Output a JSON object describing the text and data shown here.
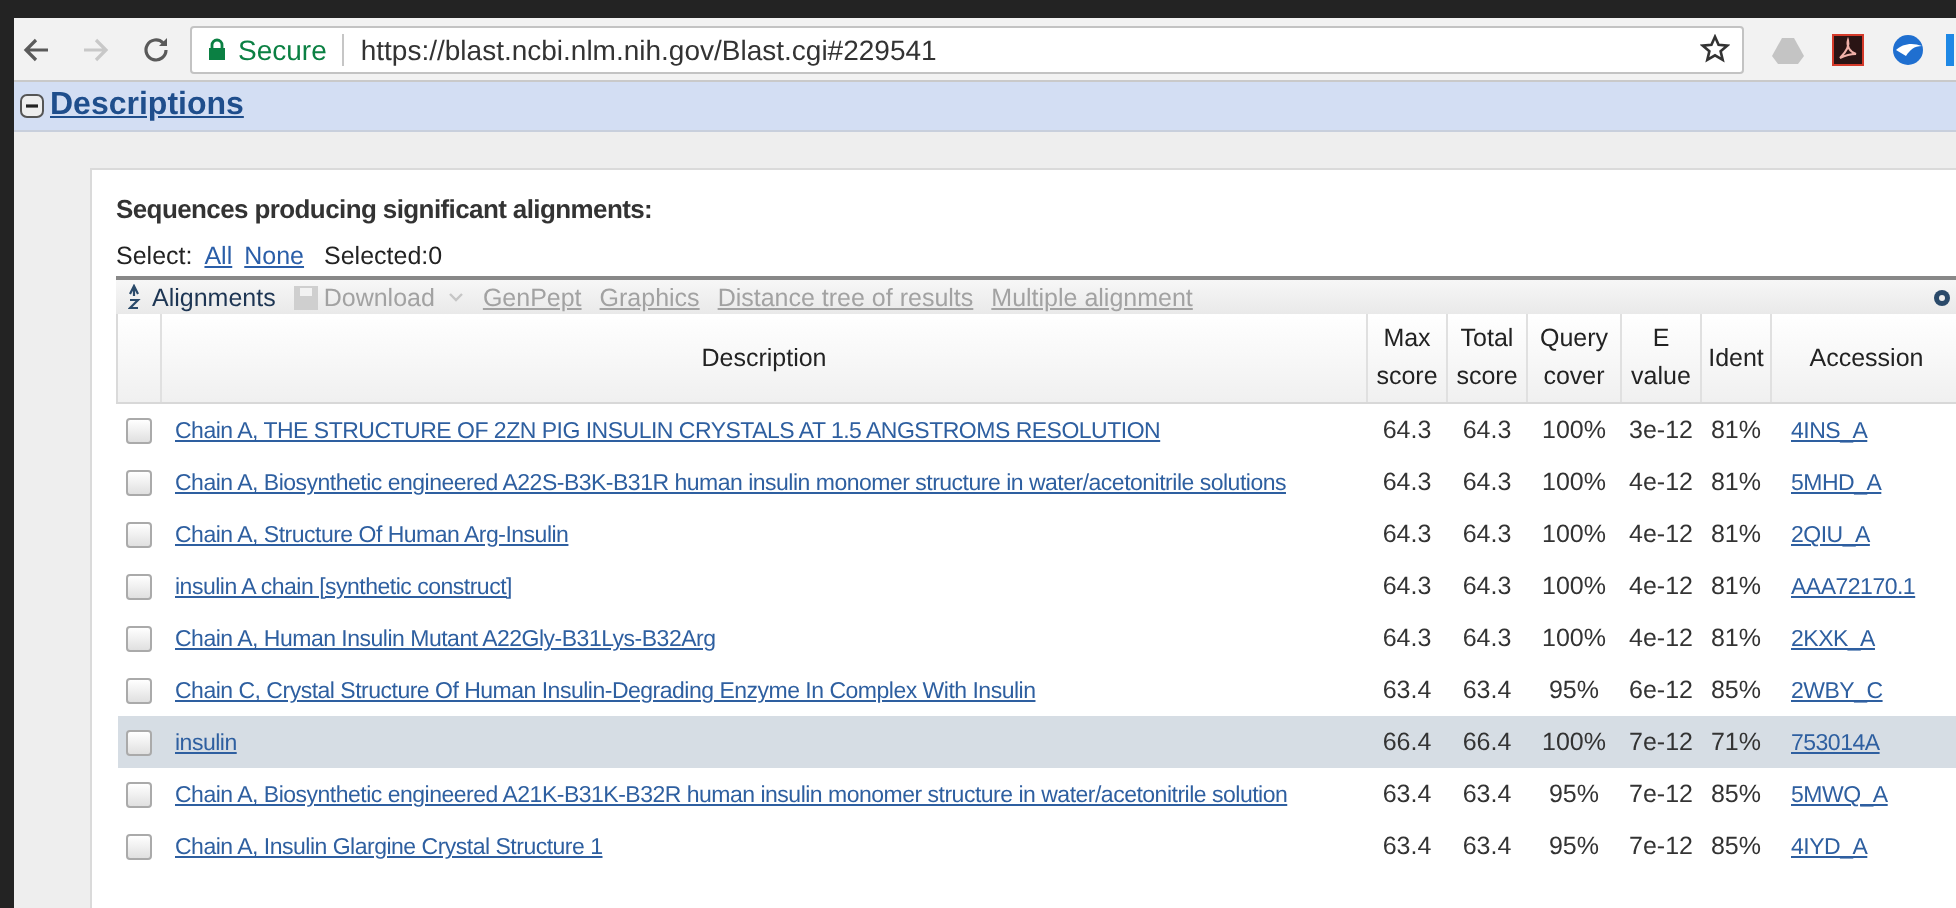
{
  "browser": {
    "secure_label": "Secure",
    "url": "https://blast.ncbi.nlm.nih.gov/Blast.cgi#229541",
    "forward_disabled": true
  },
  "section": {
    "title": "Descriptions",
    "expanded": true
  },
  "heading": "Sequences producing significant alignments:",
  "select": {
    "label": "Select:",
    "all": "All",
    "none": "None",
    "selected_count": "Selected:0"
  },
  "toolbar": [
    {
      "kind": "sort",
      "label": "Alignments",
      "disabled": false
    },
    {
      "kind": "download",
      "label": "Download",
      "disabled": true
    },
    {
      "kind": "link",
      "label": "GenPept",
      "disabled": true
    },
    {
      "kind": "link",
      "label": "Graphics",
      "disabled": true
    },
    {
      "kind": "link",
      "label": "Distance tree of results",
      "disabled": true
    },
    {
      "kind": "link",
      "label": "Multiple alignment",
      "disabled": true
    }
  ],
  "table": {
    "columns": [
      {
        "line1": "Description"
      },
      {
        "line1": "Max",
        "line2": "score"
      },
      {
        "line1": "Total",
        "line2": "score"
      },
      {
        "line1": "Query",
        "line2": "cover"
      },
      {
        "line1": "E",
        "line2": "value"
      },
      {
        "line1": "Ident"
      },
      {
        "line1": "Accession"
      }
    ],
    "rows": [
      {
        "checked": false,
        "highlighted": false,
        "description": "Chain A, THE STRUCTURE OF 2ZN PIG INSULIN CRYSTALS AT 1.5 ANGSTROMS RESOLUTION",
        "max_score": "64.3",
        "total_score": "64.3",
        "query_cover": "100%",
        "e_value": "3e-12",
        "ident": "81%",
        "accession": "4INS_A"
      },
      {
        "checked": false,
        "highlighted": false,
        "description": "Chain A, Biosynthetic engineered A22S-B3K-B31R human insulin monomer structure in water/acetonitrile solutions",
        "max_score": "64.3",
        "total_score": "64.3",
        "query_cover": "100%",
        "e_value": "4e-12",
        "ident": "81%",
        "accession": "5MHD_A"
      },
      {
        "checked": false,
        "highlighted": false,
        "description": "Chain A, Structure Of Human Arg-Insulin",
        "max_score": "64.3",
        "total_score": "64.3",
        "query_cover": "100%",
        "e_value": "4e-12",
        "ident": "81%",
        "accession": "2QIU_A"
      },
      {
        "checked": false,
        "highlighted": false,
        "description": "insulin A chain [synthetic construct]",
        "max_score": "64.3",
        "total_score": "64.3",
        "query_cover": "100%",
        "e_value": "4e-12",
        "ident": "81%",
        "accession": "AAA72170.1"
      },
      {
        "checked": false,
        "highlighted": false,
        "description": "Chain A, Human Insulin Mutant A22Gly-B31Lys-B32Arg",
        "max_score": "64.3",
        "total_score": "64.3",
        "query_cover": "100%",
        "e_value": "4e-12",
        "ident": "81%",
        "accession": "2KXK_A"
      },
      {
        "checked": false,
        "highlighted": false,
        "description": "Chain C, Crystal Structure Of Human Insulin-Degrading Enzyme In Complex With Insulin",
        "max_score": "63.4",
        "total_score": "63.4",
        "query_cover": "95%",
        "e_value": "6e-12",
        "ident": "85%",
        "accession": "2WBY_C"
      },
      {
        "checked": false,
        "highlighted": true,
        "description": "insulin",
        "max_score": "66.4",
        "total_score": "66.4",
        "query_cover": "100%",
        "e_value": "7e-12",
        "ident": "71%",
        "accession": "753014A"
      },
      {
        "checked": false,
        "highlighted": false,
        "description": "Chain A, Biosynthetic engineered A21K-B31K-B32R human insulin monomer structure in water/acetonitrile solution",
        "max_score": "63.4",
        "total_score": "63.4",
        "query_cover": "95%",
        "e_value": "7e-12",
        "ident": "85%",
        "accession": "5MWQ_A"
      },
      {
        "checked": false,
        "highlighted": false,
        "description": "Chain A, Insulin Glargine Crystal Structure 1",
        "max_score": "63.4",
        "total_score": "63.4",
        "query_cover": "95%",
        "e_value": "7e-12",
        "ident": "85%",
        "accession": "4IYD_A"
      }
    ]
  }
}
